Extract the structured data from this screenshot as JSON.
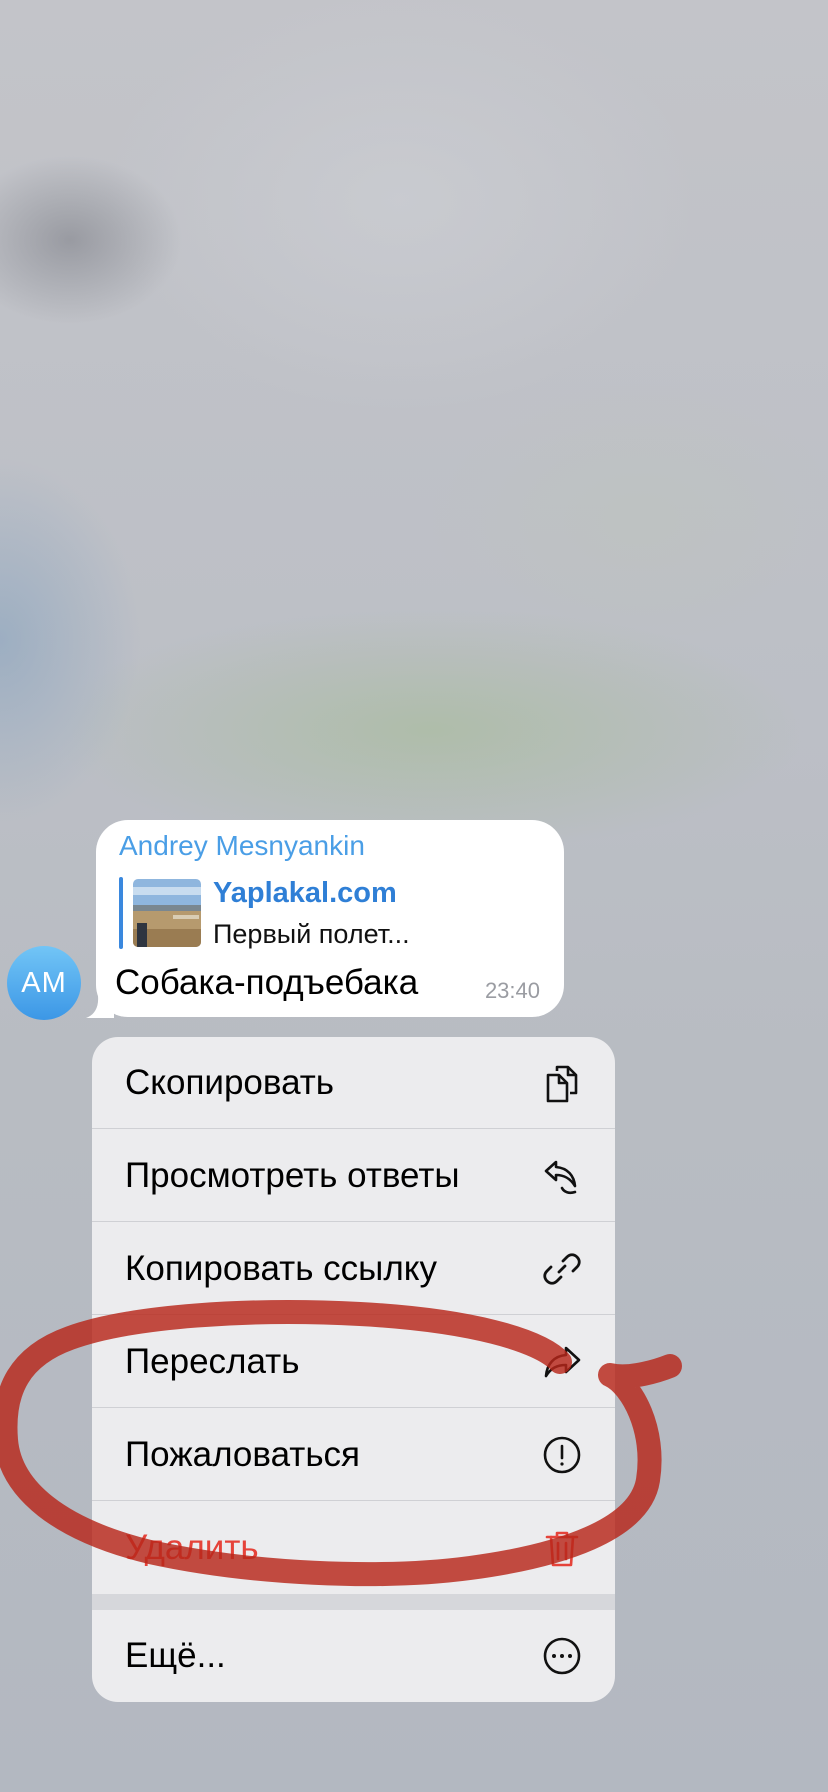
{
  "message": {
    "avatar_initials": "AM",
    "sender_name": "Andrey Mesnyankin",
    "reply": {
      "title": "Yaplakal.com",
      "text": "Первый полет..."
    },
    "text": "Собака-подъебака",
    "time": "23:40"
  },
  "context_menu": {
    "items": [
      {
        "label": "Скопировать",
        "icon": "copy-icon"
      },
      {
        "label": "Просмотреть ответы",
        "icon": "replies-icon"
      },
      {
        "label": "Копировать ссылку",
        "icon": "link-icon"
      },
      {
        "label": "Переслать",
        "icon": "forward-icon"
      },
      {
        "label": "Пожаловаться",
        "icon": "report-icon"
      },
      {
        "label": "Удалить",
        "icon": "trash-icon"
      }
    ],
    "more": {
      "label": "Ещё...",
      "icon": "more-icon"
    }
  },
  "colors": {
    "accent": "#2f7fd6",
    "sender": "#4a9ee6",
    "danger": "#e5433a",
    "annotation": "#c0392b"
  }
}
